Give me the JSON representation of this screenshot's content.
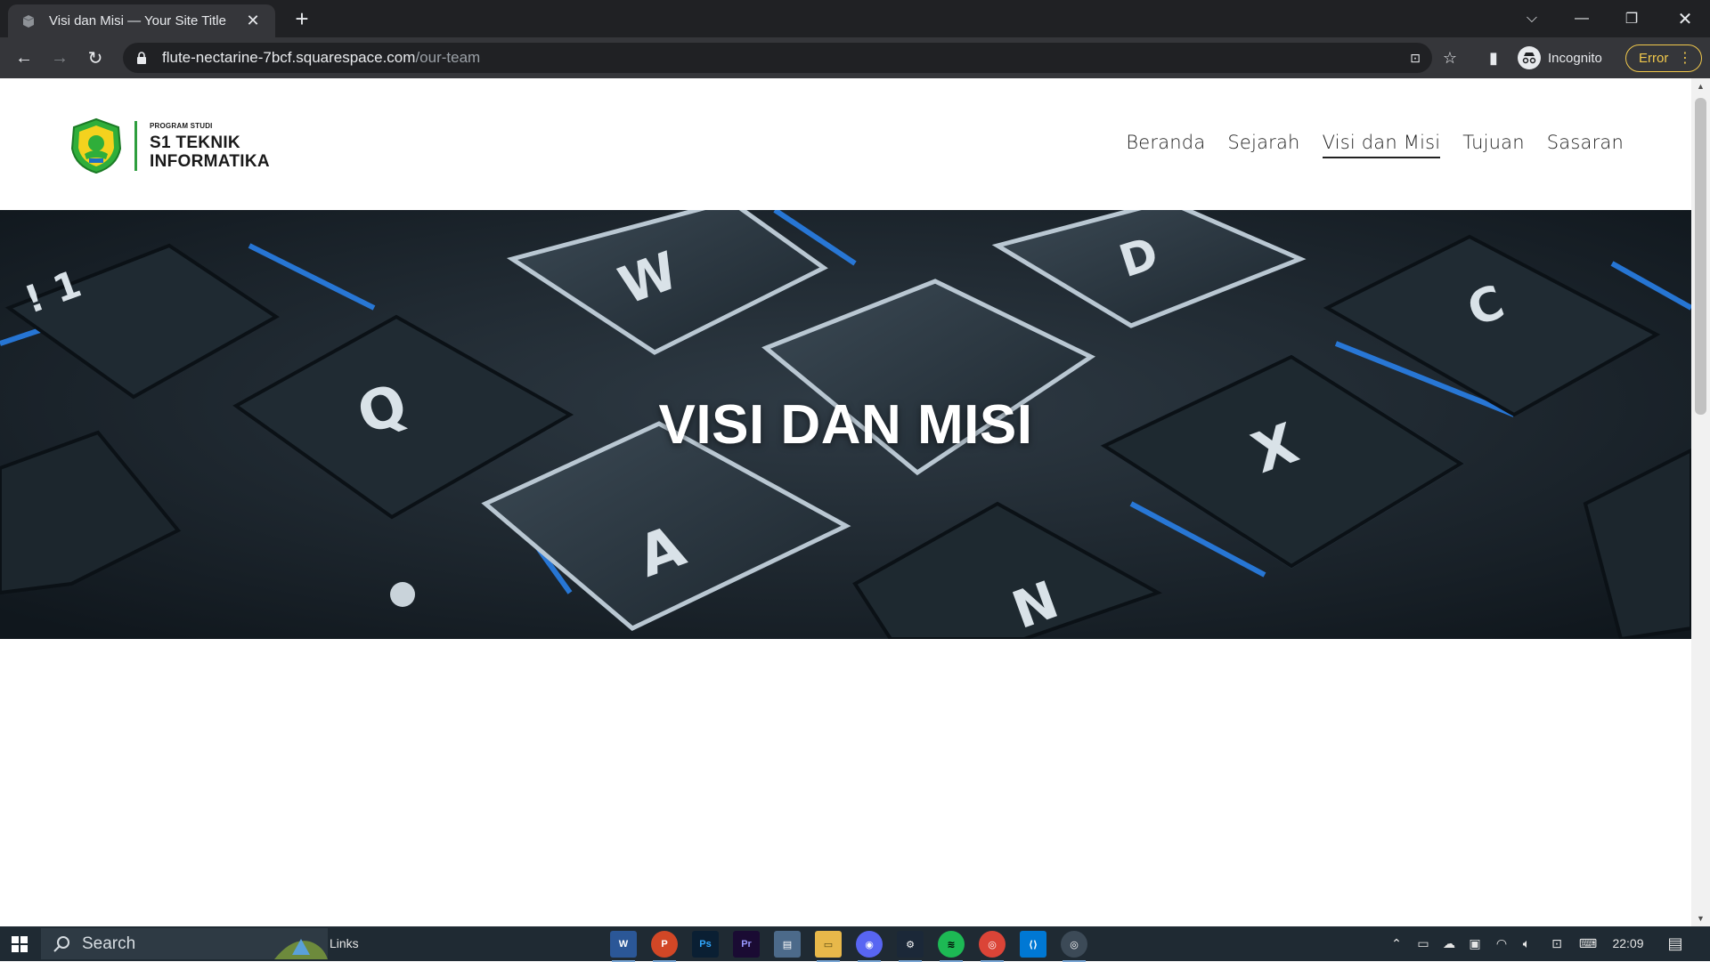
{
  "browser": {
    "tab_title": "Visi dan Misi — Your Site Title",
    "url_host": "flute-nectarine-7bcf.squarespace.com",
    "url_path": "/our-team",
    "profile_label": "Incognito",
    "error_label": "Error"
  },
  "site": {
    "logo_small": "PROGRAM STUDI",
    "logo_line1": "S1 TEKNIK",
    "logo_line2": "INFORMATIKA",
    "nav": [
      {
        "label": "Beranda"
      },
      {
        "label": "Sejarah"
      },
      {
        "label": "Visi dan Misi",
        "active": true
      },
      {
        "label": "Tujuan"
      },
      {
        "label": "Sasaran"
      }
    ],
    "hero_title": "VISI DAN MISI"
  },
  "taskbar": {
    "search_label": "Search",
    "links_label": "Links",
    "time": "22:09",
    "apps": [
      "word-icon",
      "powerpoint-icon",
      "photoshop-icon",
      "premiere-icon",
      "photos-icon",
      "explorer-icon",
      "discord-icon",
      "steam-icon",
      "spotify-icon",
      "chrome-icon",
      "vscode-icon",
      "chrome-active-icon"
    ]
  },
  "colors": {
    "chrome_dark": "#202124",
    "chrome_toolbar": "#35363a",
    "error_accent": "#f2c94c",
    "taskbar": "#1f2a33",
    "keyboard_glow": "#2a8bff"
  }
}
